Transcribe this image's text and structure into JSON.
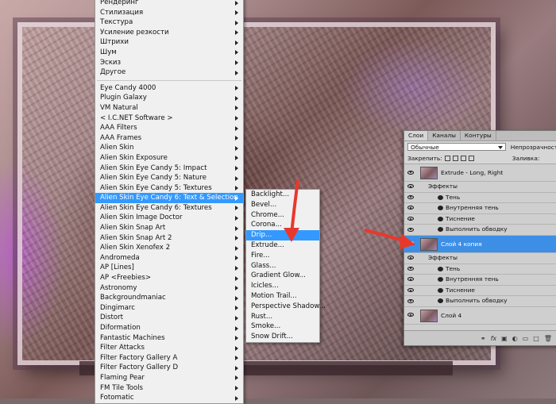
{
  "main_menu": {
    "group1": [
      {
        "label": "Рендеринг",
        "sub": true
      },
      {
        "label": "Стилизация",
        "sub": true
      },
      {
        "label": "Текстура",
        "sub": true
      },
      {
        "label": "Усиление резкости",
        "sub": true
      },
      {
        "label": "Штрихи",
        "sub": true
      },
      {
        "label": "Шум",
        "sub": true
      },
      {
        "label": "Эскиз",
        "sub": true
      },
      {
        "label": "Другое",
        "sub": true
      }
    ],
    "group2": [
      {
        "label": "Eye Candy 4000",
        "sub": true
      },
      {
        "label": "Plugin Galaxy",
        "sub": true
      },
      {
        "label": "VM Natural",
        "sub": true
      },
      {
        "label": "< I.C.NET Software >",
        "sub": true
      },
      {
        "label": "AAA Filters",
        "sub": true
      },
      {
        "label": "AAA Frames",
        "sub": true
      },
      {
        "label": "Alien Skin",
        "sub": true
      },
      {
        "label": "Alien Skin Exposure",
        "sub": true
      },
      {
        "label": "Alien Skin Eye Candy 5: Impact",
        "sub": true
      },
      {
        "label": "Alien Skin Eye Candy 5: Nature",
        "sub": true
      },
      {
        "label": "Alien Skin Eye Candy 5: Textures",
        "sub": true
      },
      {
        "label": "Alien Skin Eye Candy 6: Text & Selection",
        "sub": true,
        "highlighted": true
      },
      {
        "label": "Alien Skin Eye Candy 6: Textures",
        "sub": true
      },
      {
        "label": "Alien Skin Image Doctor",
        "sub": true
      },
      {
        "label": "Alien Skin Snap Art",
        "sub": true
      },
      {
        "label": "Alien Skin Snap Art 2",
        "sub": true
      },
      {
        "label": "Alien Skin Xenofex 2",
        "sub": true
      },
      {
        "label": "Andromeda",
        "sub": true
      },
      {
        "label": "AP [Lines]",
        "sub": true
      },
      {
        "label": "AP <Freebies>",
        "sub": true
      },
      {
        "label": "Astronomy",
        "sub": true
      },
      {
        "label": "Backgroundmaniac",
        "sub": true
      },
      {
        "label": "Dingimarc",
        "sub": true
      },
      {
        "label": "Distort",
        "sub": true
      },
      {
        "label": "Diformation",
        "sub": true
      },
      {
        "label": "Fantastic Machines",
        "sub": true
      },
      {
        "label": "Filter Attacks",
        "sub": true
      },
      {
        "label": "Filter Factory Gallery A",
        "sub": true
      },
      {
        "label": "Filter Factory Gallery D",
        "sub": true
      },
      {
        "label": "Flaming Pear",
        "sub": true
      },
      {
        "label": "FM Tile Tools",
        "sub": true
      },
      {
        "label": "Fotomatic",
        "sub": true
      }
    ]
  },
  "sub_menu": [
    {
      "label": "Backlight..."
    },
    {
      "label": "Bevel..."
    },
    {
      "label": "Chrome..."
    },
    {
      "label": "Corona..."
    },
    {
      "label": "Drip...",
      "highlighted": true
    },
    {
      "label": "Extrude..."
    },
    {
      "label": "Fire..."
    },
    {
      "label": "Glass..."
    },
    {
      "label": "Gradient Glow..."
    },
    {
      "label": "Icicles..."
    },
    {
      "label": "Motion Trail..."
    },
    {
      "label": "Perspective Shadow..."
    },
    {
      "label": "Rust..."
    },
    {
      "label": "Smoke..."
    },
    {
      "label": "Snow Drift..."
    }
  ],
  "layers_panel": {
    "tabs": [
      "Слои",
      "Каналы",
      "Контуры"
    ],
    "blend_mode": "Обычные",
    "opacity_label": "Непрозрачность:",
    "lock_label": "Закрепить:",
    "fill_label": "Заливка:",
    "layers": [
      {
        "type": "layer",
        "name": "Extrude - Long, Right",
        "selected": false
      },
      {
        "type": "effects",
        "name": "Эффекты"
      },
      {
        "type": "effect",
        "name": "Тень"
      },
      {
        "type": "effect",
        "name": "Внутренняя тень"
      },
      {
        "type": "effect",
        "name": "Тиснение"
      },
      {
        "type": "effect",
        "name": "Выполнить обводку"
      },
      {
        "type": "layer",
        "name": "Слой 4 копия",
        "selected": true
      },
      {
        "type": "effects",
        "name": "Эффекты"
      },
      {
        "type": "effect",
        "name": "Тень"
      },
      {
        "type": "effect",
        "name": "Внутренняя тень"
      },
      {
        "type": "effect",
        "name": "Тиснение"
      },
      {
        "type": "effect",
        "name": "Выполнить обводку"
      },
      {
        "type": "layer",
        "name": "Слой 4",
        "selected": false
      }
    ]
  },
  "colors": {
    "highlight": "#3399ff",
    "arrow": "#e8382c",
    "selected_layer": "#3d8fe6"
  }
}
